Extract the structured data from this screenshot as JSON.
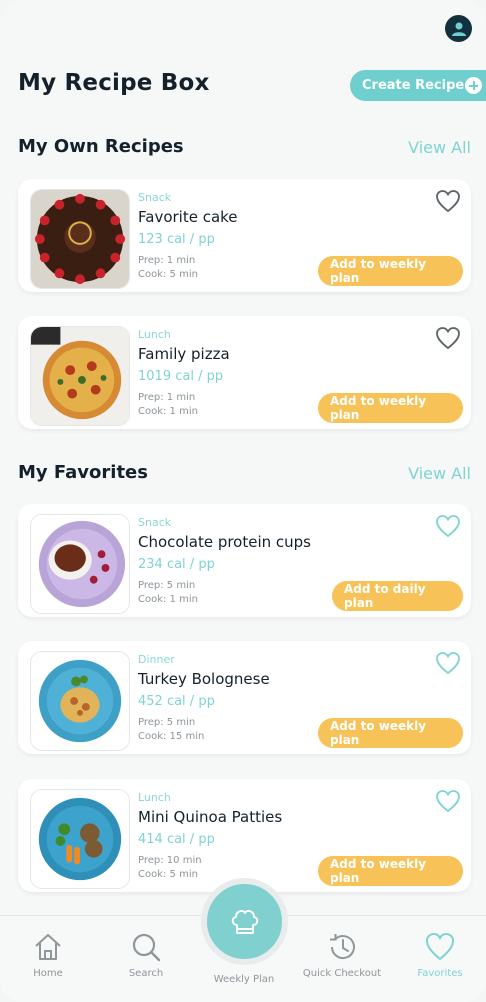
{
  "header": {
    "title": "My Recipe Box",
    "create_label": "Create Recipe"
  },
  "own": {
    "title": "My Own Recipes",
    "view_all": "View All",
    "items": [
      {
        "meal": "Snack",
        "name": "Favorite cake",
        "cal": "123 cal / pp",
        "prep": "Prep: 1 min",
        "cook": "Cook: 5 min",
        "action": "Add to weekly plan"
      },
      {
        "meal": "Lunch",
        "name": "Family pizza",
        "cal": "1019 cal / pp",
        "prep": "Prep: 1 min",
        "cook": "Cook: 1 min",
        "action": "Add to weekly plan"
      }
    ]
  },
  "favorites": {
    "title": "My Favorites",
    "view_all": "View All",
    "items": [
      {
        "meal": "Snack",
        "name": "Chocolate protein cups",
        "cal": "234 cal / pp",
        "prep": "Prep: 5 min",
        "cook": "Cook: 1 min",
        "action": "Add to daily plan"
      },
      {
        "meal": "Dinner",
        "name": "Turkey Bolognese",
        "cal": "452 cal / pp",
        "prep": "Prep: 5 min",
        "cook": "Cook: 15 min",
        "action": "Add to weekly plan"
      },
      {
        "meal": "Lunch",
        "name": "Mini Quinoa Patties",
        "cal": "414 cal / pp",
        "prep": "Prep: 10 min",
        "cook": "Cook: 5 min",
        "action": "Add to weekly plan"
      }
    ]
  },
  "nav": {
    "home": "Home",
    "search": "Search",
    "weekly_plan": "Weekly Plan",
    "quick_checkout": "Quick Checkout",
    "favorites": "Favorites"
  },
  "icons": {
    "avatar": "user-avatar-icon",
    "heart": "heart-icon",
    "home": "home-icon",
    "search": "search-icon",
    "chef_hat": "chef-hat-icon",
    "history": "history-icon"
  },
  "colors": {
    "accent": "#7fd3d3",
    "action": "#f7c257",
    "title": "#14212b"
  }
}
